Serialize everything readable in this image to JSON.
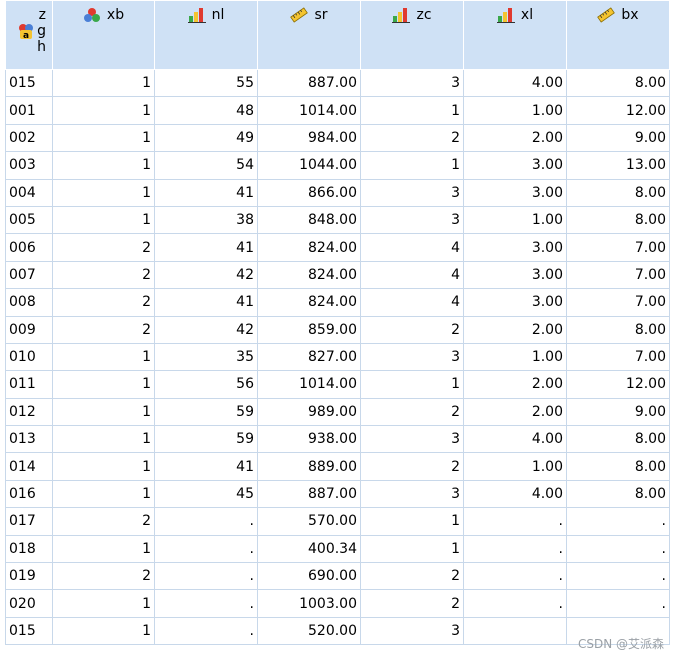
{
  "columns": [
    {
      "name": "z",
      "name_lines": [
        "z",
        "g",
        "h"
      ],
      "icon": "string-nominal-icon"
    },
    {
      "name": "xb",
      "icon": "nominal-icon"
    },
    {
      "name": "nl",
      "icon": "ordinal-icon"
    },
    {
      "name": "sr",
      "icon": "scale-icon"
    },
    {
      "name": "zc",
      "icon": "ordinal-icon"
    },
    {
      "name": "xl",
      "icon": "ordinal-icon"
    },
    {
      "name": "bx",
      "icon": "scale-icon"
    }
  ],
  "rows": [
    [
      "015",
      "1",
      "55",
      "887.00",
      "3",
      "4.00",
      "8.00"
    ],
    [
      "001",
      "1",
      "48",
      "1014.00",
      "1",
      "1.00",
      "12.00"
    ],
    [
      "002",
      "1",
      "49",
      "984.00",
      "2",
      "2.00",
      "9.00"
    ],
    [
      "003",
      "1",
      "54",
      "1044.00",
      "1",
      "3.00",
      "13.00"
    ],
    [
      "004",
      "1",
      "41",
      "866.00",
      "3",
      "3.00",
      "8.00"
    ],
    [
      "005",
      "1",
      "38",
      "848.00",
      "3",
      "1.00",
      "8.00"
    ],
    [
      "006",
      "2",
      "41",
      "824.00",
      "4",
      "3.00",
      "7.00"
    ],
    [
      "007",
      "2",
      "42",
      "824.00",
      "4",
      "3.00",
      "7.00"
    ],
    [
      "008",
      "2",
      "41",
      "824.00",
      "4",
      "3.00",
      "7.00"
    ],
    [
      "009",
      "2",
      "42",
      "859.00",
      "2",
      "2.00",
      "8.00"
    ],
    [
      "010",
      "1",
      "35",
      "827.00",
      "3",
      "1.00",
      "7.00"
    ],
    [
      "011",
      "1",
      "56",
      "1014.00",
      "1",
      "2.00",
      "12.00"
    ],
    [
      "012",
      "1",
      "59",
      "989.00",
      "2",
      "2.00",
      "9.00"
    ],
    [
      "013",
      "1",
      "59",
      "938.00",
      "3",
      "4.00",
      "8.00"
    ],
    [
      "014",
      "1",
      "41",
      "889.00",
      "2",
      "1.00",
      "8.00"
    ],
    [
      "016",
      "1",
      "45",
      "887.00",
      "3",
      "4.00",
      "8.00"
    ],
    [
      "017",
      "2",
      ".",
      "570.00",
      "1",
      ".",
      "."
    ],
    [
      "018",
      "1",
      ".",
      "400.34",
      "1",
      ".",
      "."
    ],
    [
      "019",
      "2",
      ".",
      "690.00",
      "2",
      ".",
      "."
    ],
    [
      "020",
      "1",
      ".",
      "1003.00",
      "2",
      ".",
      "."
    ],
    [
      "015",
      "1",
      ".",
      "520.00",
      "3",
      "",
      ""
    ]
  ],
  "watermark": "CSDN @艾派森",
  "colors": {
    "header_bg": "#cfe1f5",
    "grid_line": "#c8d8ea"
  }
}
